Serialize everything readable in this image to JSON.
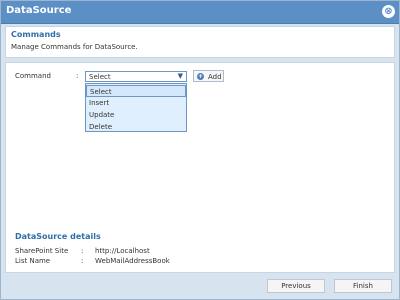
{
  "window": {
    "title": "DataSource",
    "close_label": "⊗"
  },
  "header": {
    "title": "Commands",
    "description": "Manage Commands for DataSource."
  },
  "form": {
    "command_label": "Command",
    "colon": ":",
    "select": {
      "value": "Select",
      "options": [
        "Select",
        "Insert",
        "Update",
        "Delete"
      ]
    },
    "add_label": "Add"
  },
  "details": {
    "title": "DataSource details",
    "rows": [
      {
        "label": "SharePoint Site",
        "value": "http://Localhost"
      },
      {
        "label": "List Name",
        "value": "WebMailAddressBook"
      }
    ]
  },
  "footer": {
    "previous_label": "Previous",
    "finish_label": "Finish"
  }
}
